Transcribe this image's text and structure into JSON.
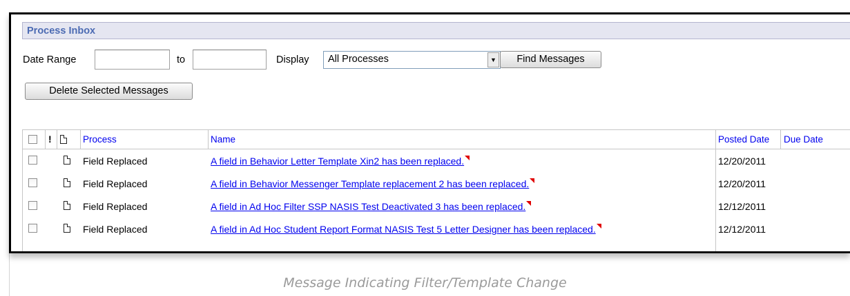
{
  "panel": {
    "title": "Process Inbox"
  },
  "filters": {
    "date_range_label": "Date Range",
    "from_value": "",
    "to_label": "to",
    "to_value": "",
    "display_label": "Display",
    "display_selected": "All Processes",
    "find_button": "Find Messages",
    "delete_button": "Delete Selected Messages"
  },
  "table": {
    "priority_header": "!",
    "columns": {
      "process": "Process",
      "name": "Name",
      "posted": "Posted Date",
      "due": "Due Date"
    },
    "rows": [
      {
        "process": "Field Replaced",
        "name": "A field in Behavior Letter Template Xin2 has been replaced.",
        "posted": "12/20/2011",
        "due": ""
      },
      {
        "process": "Field Replaced",
        "name": "A field in Behavior Messenger Template replacement 2 has been replaced.",
        "posted": "12/20/2011",
        "due": ""
      },
      {
        "process": "Field Replaced",
        "name": "A field in Ad Hoc Filter SSP NASIS Test Deactivated 3 has been replaced.",
        "posted": "12/12/2011",
        "due": ""
      },
      {
        "process": "Field Replaced",
        "name": "A field in Ad Hoc Student Report Format NASIS Test 5 Letter Designer has been replaced.",
        "posted": "12/12/2011",
        "due": ""
      }
    ]
  },
  "caption": "Message Indicating Filter/Template Change",
  "colors": {
    "title_text": "#4c6bb3",
    "title_bg": "#e5e6f1",
    "link": "#0000ee",
    "flag": "#e00000"
  }
}
